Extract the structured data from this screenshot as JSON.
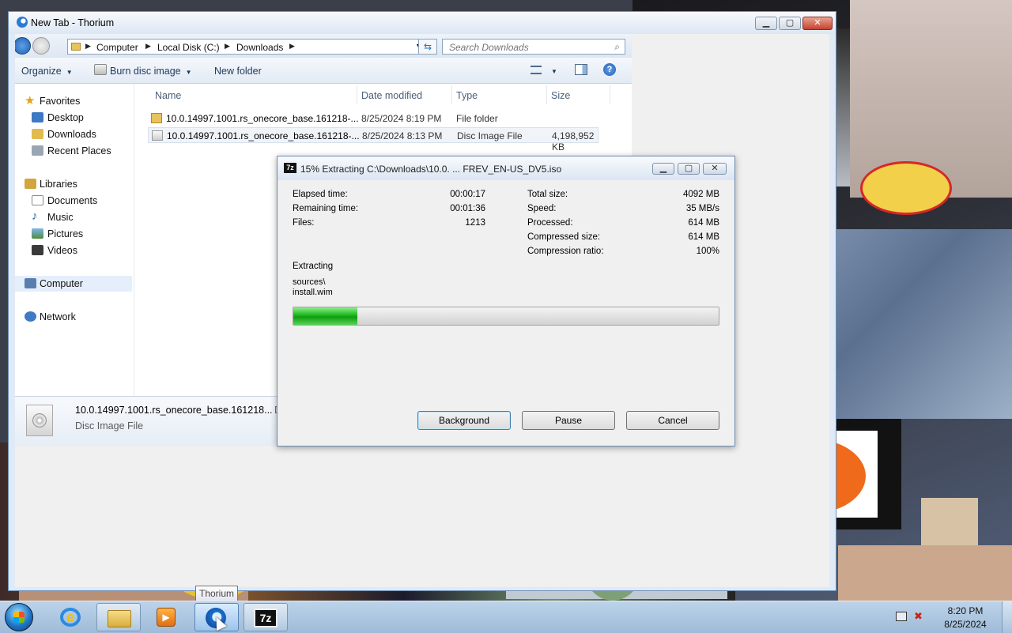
{
  "browser": {
    "title": "New Tab - Thorium"
  },
  "explorer": {
    "breadcrumb": [
      "Computer",
      "Local Disk (C:)",
      "Downloads"
    ],
    "search_placeholder": "Search Downloads",
    "toolbar": {
      "organize": "Organize",
      "burn": "Burn disc image",
      "new_folder": "New folder"
    },
    "nav": {
      "favorites": "Favorites",
      "desktop": "Desktop",
      "downloads": "Downloads",
      "recent_places": "Recent Places",
      "libraries": "Libraries",
      "documents": "Documents",
      "music": "Music",
      "pictures": "Pictures",
      "videos": "Videos",
      "computer": "Computer",
      "network": "Network"
    },
    "columns": {
      "name": "Name",
      "date_modified": "Date modified",
      "type": "Type",
      "size": "Size"
    },
    "files": [
      {
        "name": "10.0.14997.1001.rs_onecore_base.161218-...",
        "date": "8/25/2024 8:19 PM",
        "type": "File folder",
        "size": ""
      },
      {
        "name": "10.0.14997.1001.rs_onecore_base.161218-...",
        "date": "8/25/2024 8:13 PM",
        "type": "Disc Image File",
        "size": "4,198,952 KB"
      }
    ],
    "details": {
      "name": "10.0.14997.1001.rs_onecore_base.161218...",
      "type": "Disc Image File",
      "truncated_label": "Da"
    }
  },
  "zip_dialog": {
    "logo": "7z",
    "title": "15% Extracting C:\\Downloads\\10.0. ... FREV_EN-US_DV5.iso",
    "progress": 0.15,
    "left_stats": [
      {
        "label": "Elapsed time:",
        "value": "00:00:17"
      },
      {
        "label": "Remaining time:",
        "value": "00:01:36"
      },
      {
        "label": "Files:",
        "value": "1213"
      }
    ],
    "right_stats": [
      {
        "label": "Total size:",
        "value": "4092 MB"
      },
      {
        "label": "Speed:",
        "value": "35 MB/s"
      },
      {
        "label": "Processed:",
        "value": "614 MB"
      },
      {
        "label": "Compressed size:",
        "value": "614 MB"
      },
      {
        "label": "Compression ratio:",
        "value": "100%"
      }
    ],
    "status": "Extracting",
    "current_path": "sources\\",
    "current_file": "install.wim",
    "buttons": {
      "background": "Background",
      "pause": "Pause",
      "cancel": "Cancel"
    }
  },
  "taskbar": {
    "tooltip": "Thorium",
    "clock_time": "8:20 PM",
    "clock_date": "8/25/2024",
    "zip_label": "7z"
  }
}
